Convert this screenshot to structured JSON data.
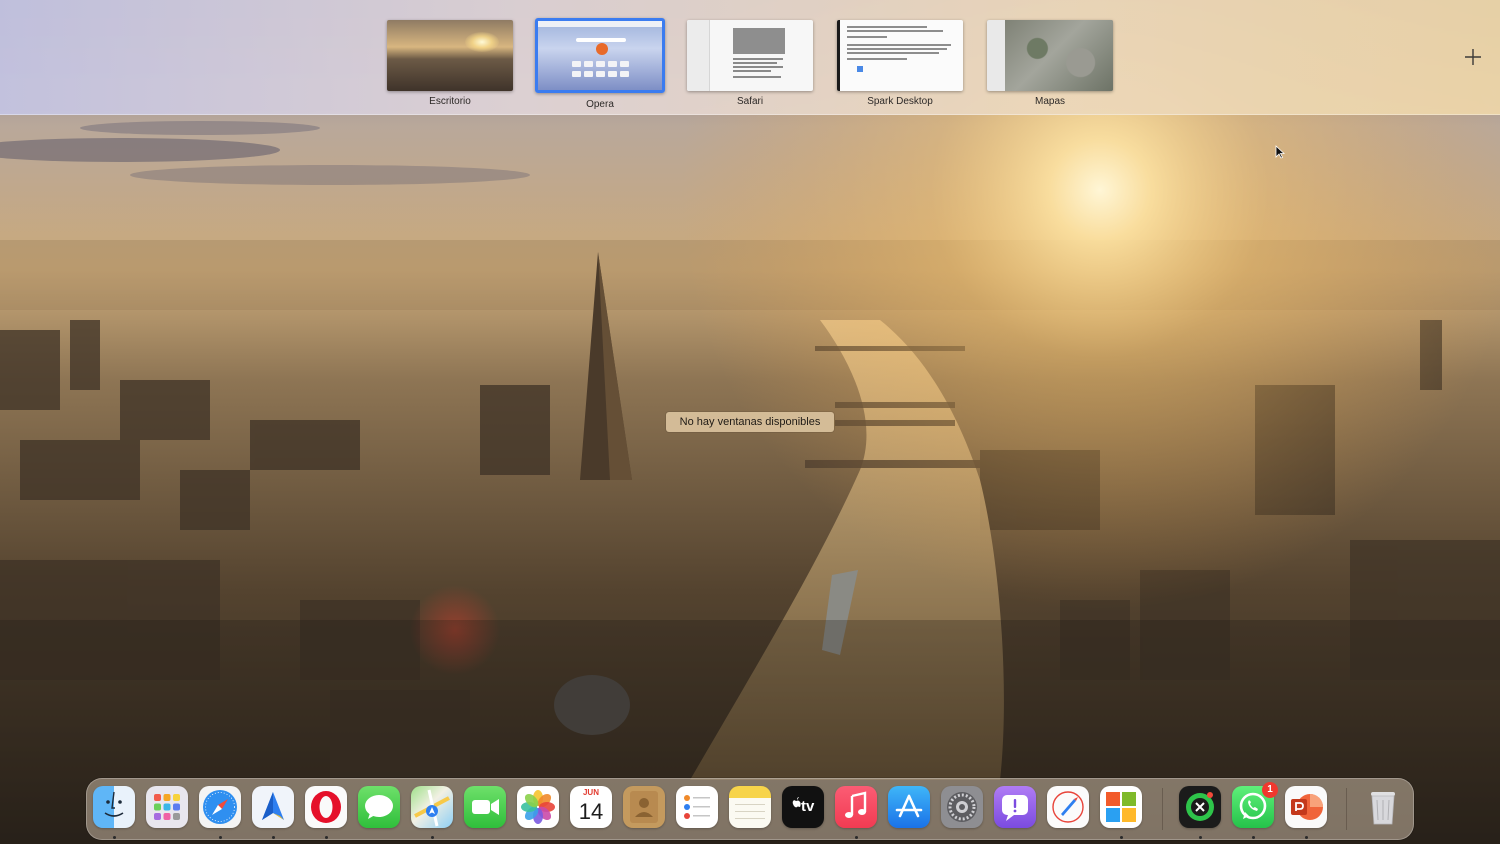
{
  "spaces": [
    {
      "label": "Escritorio",
      "selected": false
    },
    {
      "label": "Opera",
      "selected": true
    },
    {
      "label": "Safari",
      "selected": false
    },
    {
      "label": "Spark Desktop",
      "selected": false
    },
    {
      "label": "Mapas",
      "selected": false
    }
  ],
  "add_space_icon": "plus-icon",
  "message": "No hay ventanas disponibles",
  "dock": {
    "apps": [
      {
        "name": "finder",
        "running": true
      },
      {
        "name": "launchpad",
        "running": false
      },
      {
        "name": "safari",
        "running": true
      },
      {
        "name": "spark",
        "running": true
      },
      {
        "name": "opera",
        "running": true
      },
      {
        "name": "messages",
        "running": false
      },
      {
        "name": "maps",
        "running": true
      },
      {
        "name": "facetime",
        "running": false
      },
      {
        "name": "photos",
        "running": false
      },
      {
        "name": "calendar",
        "running": false,
        "month": "JUN",
        "day": "14"
      },
      {
        "name": "contacts",
        "running": false
      },
      {
        "name": "reminders",
        "running": false
      },
      {
        "name": "notes",
        "running": false
      },
      {
        "name": "apple-tv",
        "running": false,
        "label": "tv"
      },
      {
        "name": "music",
        "running": true
      },
      {
        "name": "app-store",
        "running": false
      },
      {
        "name": "system-preferences",
        "running": false
      },
      {
        "name": "feedback-assistant",
        "running": false
      },
      {
        "name": "rocket",
        "running": false
      },
      {
        "name": "microsoft-apps",
        "running": true
      },
      {
        "name": "screen-recorder",
        "running": true
      },
      {
        "name": "whatsapp",
        "running": true,
        "badge": "1"
      },
      {
        "name": "powerpoint",
        "running": true
      },
      {
        "name": "trash",
        "running": false
      }
    ]
  },
  "colors": {
    "selection": "#3b7cf0",
    "badge": "#f0382e"
  }
}
